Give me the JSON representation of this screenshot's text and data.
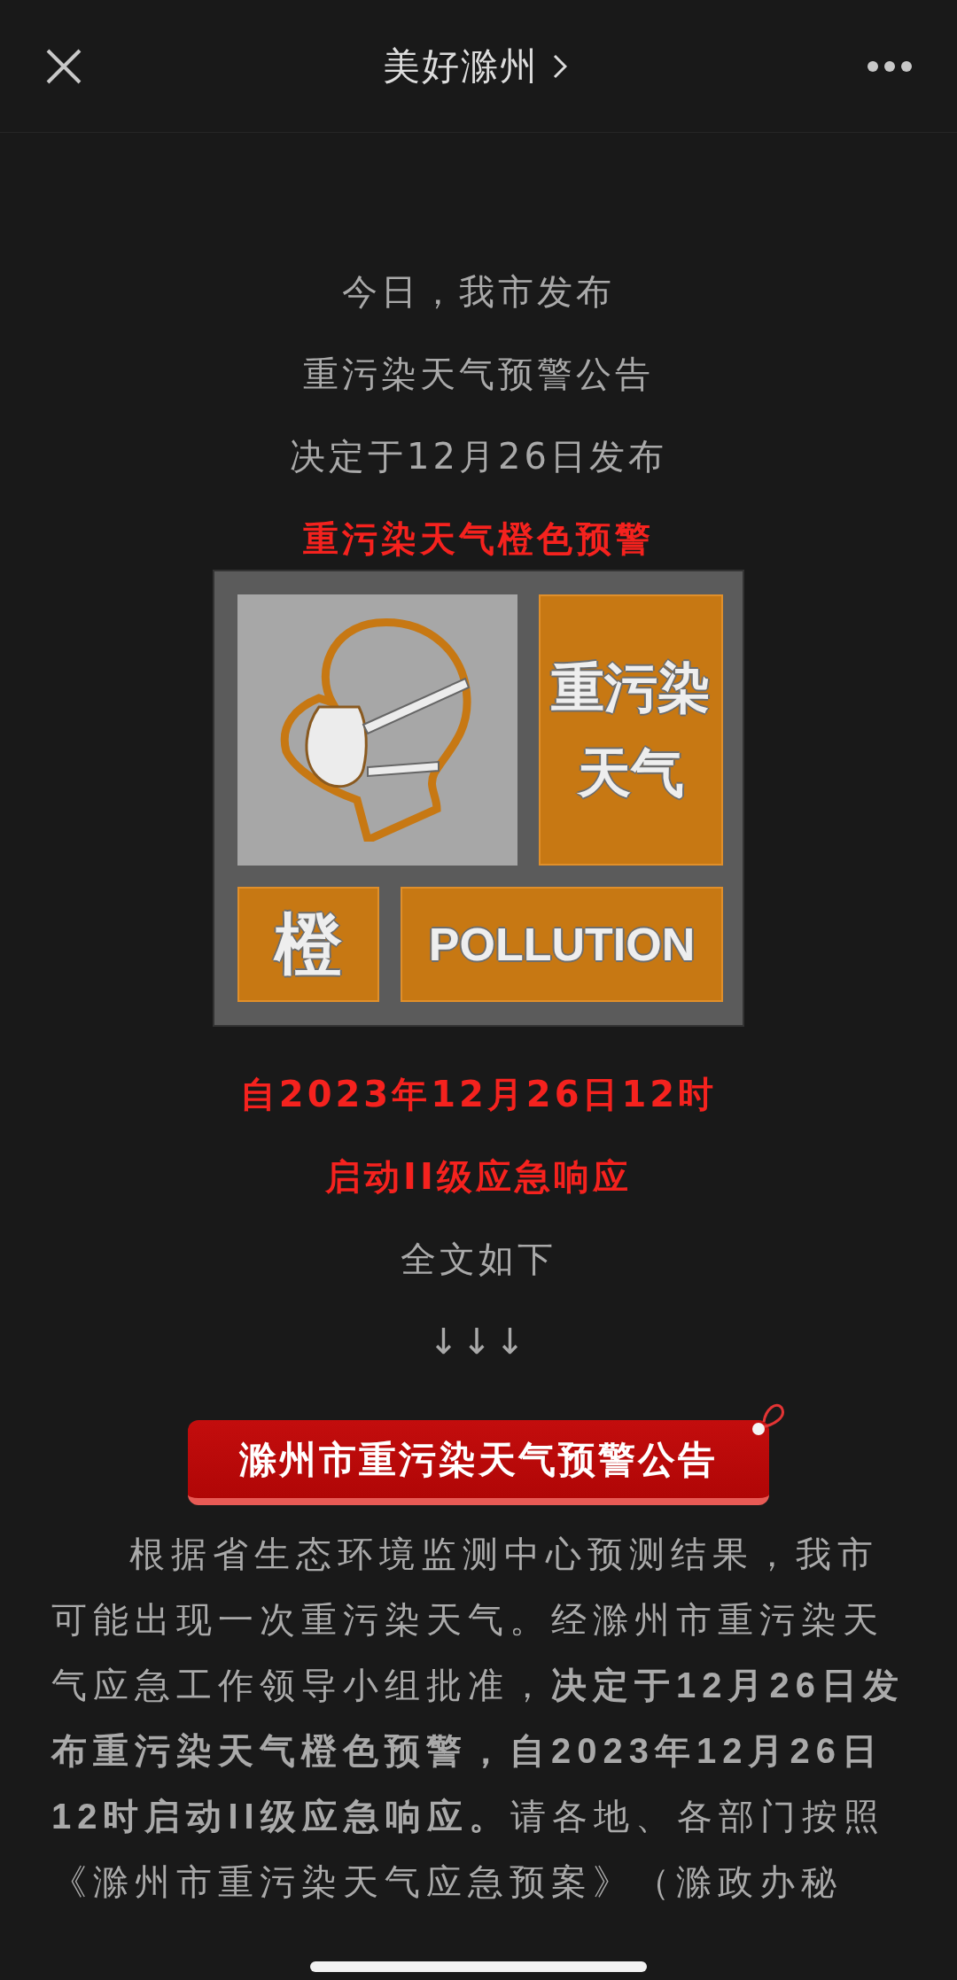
{
  "nav": {
    "title": "美好滁州"
  },
  "intro_lines": [
    {
      "text": "今日，我市发布",
      "kind": "plain"
    },
    {
      "text": "重污染天气预警公告",
      "kind": "plain"
    },
    {
      "text": "决定于12月26日发布",
      "kind": "plain"
    },
    {
      "text": "重污染天气橙色预警",
      "kind": "highlight"
    }
  ],
  "sign": {
    "title_lines": [
      "重污染",
      "天气"
    ],
    "level": "橙",
    "label": "POLLUTION"
  },
  "notice_lines": [
    {
      "text": "自2023年12月26日12时",
      "kind": "highlight"
    },
    {
      "text": "启动II级应急响应",
      "kind": "highlight"
    },
    {
      "text": "全文如下",
      "kind": "plain"
    },
    {
      "text": "↓↓↓",
      "kind": "plain"
    }
  ],
  "section_title": "滁州市重污染天气预警公告",
  "paragraph": "根据省生态环境监测中心预测结果，我市可能出现一次重污染天气。经滁州市重污染天气应急工作领导小组批准，**决定于12月26日发布重污染天气橙色预警，自2023年12月26日12时启动II级应急响应。**请各地、各部门按照《滁州市重污染天气应急预案》（滁政办秘"
}
